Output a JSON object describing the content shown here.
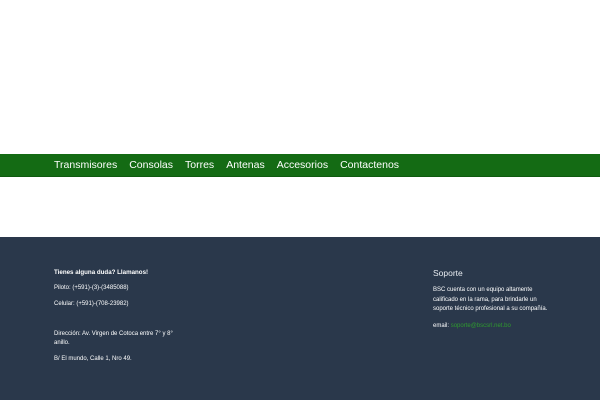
{
  "nav": {
    "items": [
      {
        "label": "Transmisores"
      },
      {
        "label": "Consolas"
      },
      {
        "label": "Torres"
      },
      {
        "label": "Antenas"
      },
      {
        "label": "Accesorios"
      },
      {
        "label": "Contactenos"
      }
    ]
  },
  "footer": {
    "contact": {
      "heading": "Tienes alguna duda? Llamanos!",
      "piloto": "Piloto: (+591)-(3)-(3485088)",
      "celular": "Celular: (+591)-(708-23982)",
      "direccion_line1": "Dirección: Av. Virgen de Cotoca entre 7° y 8°",
      "direccion_line2": "anillo.",
      "barrio": "B/ El mundo, Calle 1, Nro 49."
    },
    "support": {
      "title": "Soporte",
      "text_line1": "BSC cuenta con un equipo altamente",
      "text_line2": "calificado en la rama, para brindarle un",
      "text_line3": "soporte técnico profesional a su compañía.",
      "email_label": "email:",
      "email_value": "soporte@bscsrl.net.bo"
    }
  },
  "colors": {
    "nav_bg": "#146b14",
    "footer_bg": "#2a384b",
    "link_green": "#2e9a2e"
  }
}
